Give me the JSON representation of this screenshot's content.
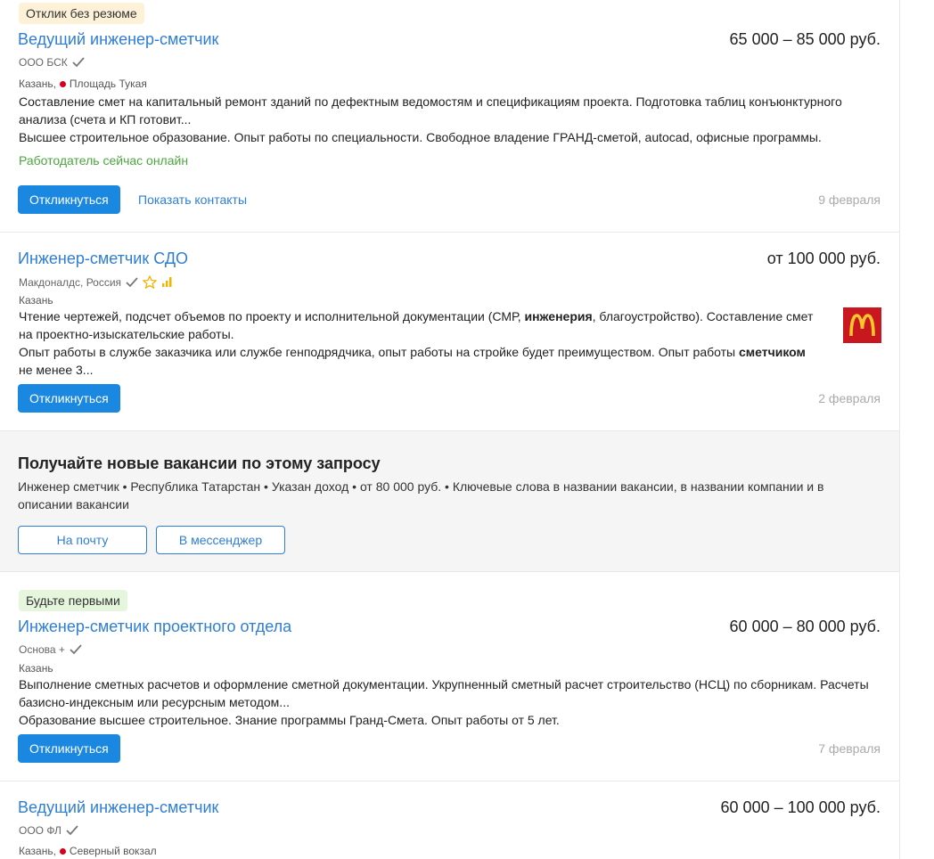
{
  "vacancies": [
    {
      "badge": "Отклик без резюме",
      "title": "Ведущий инженер-сметчик",
      "salary": "65 000 – 85 000 руб.",
      "company": "ООО БСК",
      "city": "Казань,",
      "metro": "Площадь Тукая",
      "desc_line1": "Составление смет на капитальный ремонт зданий по дефектным ведомостям и спецификациям проекта. Подготовка таблиц конъюнктурного анализа (счета и КП готовит...",
      "desc_line2": "Высшее строительное образование. Опыт работы по специальности. Свободное владение ГРАНД-сметой, autocad, офисные программы.",
      "online": "Работодатель сейчас онлайн",
      "respond": "Откликнуться",
      "show_contacts": "Показать контакты",
      "date": "9 февраля"
    },
    {
      "title": "Инженер-сметчик СДО",
      "salary": "от 100 000 руб.",
      "company": "Макдоналдс, Россия",
      "city": "Казань",
      "desc1_a": "Чтение чертежей, подсчет объемов по проекту и исполнительной документации (СМР, ",
      "desc1_b": "инженерия",
      "desc1_c": ", благоустройство). Составление смет на проектно-изыскательские работы.",
      "desc2_a": "Опыт работы в службе заказчика или службе генподрядчика, опыт работы на стройке будет преимуществом. Опыт работы ",
      "desc2_b": "сметчиком",
      "desc2_c": " не менее 3...",
      "respond": "Откликнуться",
      "date": "2 февраля"
    },
    {
      "badge": "Будьте первыми",
      "title": "Инженер-сметчик проектного отдела",
      "salary": "60 000 – 80 000 руб.",
      "company": "Основа +",
      "city": "Казань",
      "desc_line1": "Выполнение сметных расчетов и оформление сметной документации. Укрупненный сметный расчет строительство (НСЦ) по сборникам. Расчеты базисно-индексным или ресурсным методом...",
      "desc_line2": "Образование высшее строительное. Знание программы Гранд-Смета. Опыт работы от 5 лет.",
      "respond": "Откликнуться",
      "date": "7 февраля"
    },
    {
      "title": "Ведущий инженер-сметчик",
      "salary": "60 000 – 100 000 руб.",
      "company": "ООО ФЛ",
      "city": "Казань,",
      "metro": "Северный вокзал"
    }
  ],
  "promo": {
    "title": "Получайте новые вакансии по этому запросу",
    "text": "Инженер сметчик • Республика Татарстан • Указан доход • от 80 000 руб. • Ключевые слова в названии вакансии, в названии компании и в описании вакансии",
    "email_button": "На почту",
    "messenger_button": "В мессенджер"
  },
  "colors": {
    "link": "#2e7ed6",
    "primary_button": "#1a87e1",
    "online_green": "#4aa63d",
    "metro_red": "#d6001c",
    "badge_yellow": "#fdf1d7",
    "badge_green": "#e5f6dc",
    "mcd_red": "#c8171e",
    "mcd_yellow": "#ffc72c"
  }
}
